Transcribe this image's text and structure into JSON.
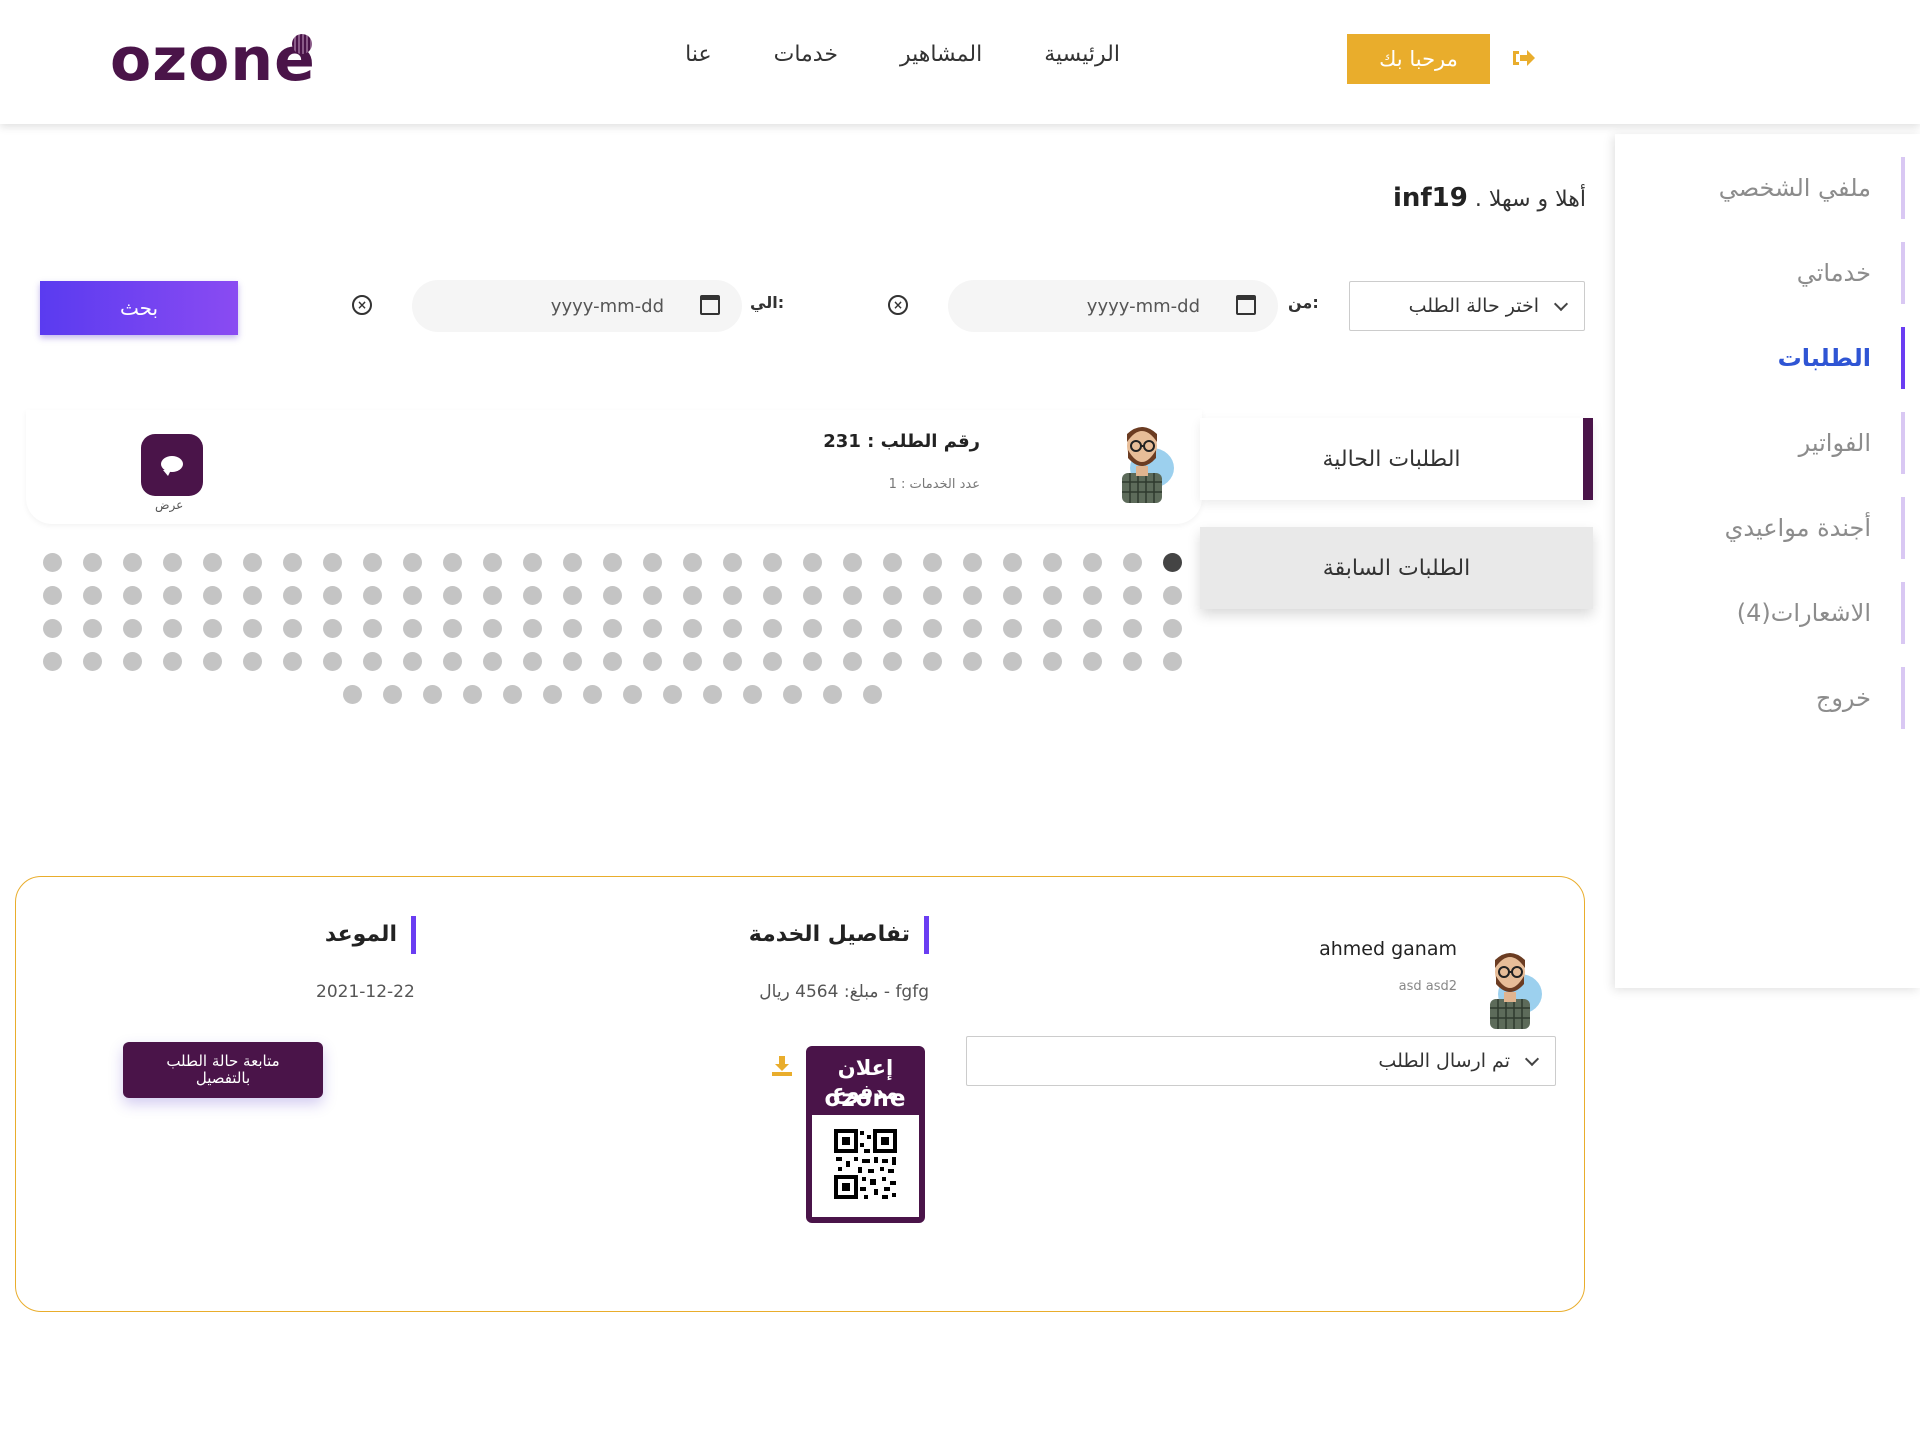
{
  "header": {
    "logo": "ozone",
    "nav": [
      "الرئيسية",
      "المشاهير",
      "خدمات",
      "عنا"
    ],
    "welcome_button": "مرحبا بك"
  },
  "sidebar": {
    "items": [
      {
        "label": "ملفي الشخصي",
        "active": false
      },
      {
        "label": "خدماتي",
        "active": false
      },
      {
        "label": "الطلبات",
        "active": true
      },
      {
        "label": "الفواتير",
        "active": false
      },
      {
        "label": "أجندة مواعيدي",
        "active": false
      },
      {
        "label": "الاشعارات(4)",
        "active": false
      },
      {
        "label": "خروج",
        "active": false
      }
    ]
  },
  "greeting": {
    "prefix": "أهلا و سهلا .",
    "username": "inf19"
  },
  "filters": {
    "status_placeholder": "اختر حالة الطلب",
    "from_label": "من:",
    "to_label": "الي:",
    "from_date": "yyyy-mm-dd",
    "to_date": "yyyy-mm-dd",
    "search_button": "بحث"
  },
  "tabs": {
    "current": "الطلبات الحالية",
    "previous": "الطلبات السابقة"
  },
  "request": {
    "number_label": "رقم الطلب : 231",
    "services_count": "عدد الخدمات : 1",
    "view_label": "عرض"
  },
  "pagination": {
    "rows": [
      29,
      29,
      29,
      29,
      14
    ],
    "active_index": 0
  },
  "detail": {
    "client_name": "ahmed ganam",
    "client_sub": "asd asd2",
    "status": "تم ارسال الطلب",
    "service_title": "تفاصيل الخدمة",
    "service_desc": "fgfg - مبلغ: 4564 ريال",
    "appointment_title": "الموعد",
    "appointment_date": "2021-12-22",
    "track_button_line1": "متابعة حالة الطلب",
    "track_button_line2": "بالتفصيل",
    "ad_text": "إعلان مدفوع",
    "ad_logo": "ozone"
  },
  "colors": {
    "brand": "#4a1449",
    "accent": "#e9ad2c",
    "primary": "#6a3df2",
    "active_link": "#2f55d4"
  }
}
